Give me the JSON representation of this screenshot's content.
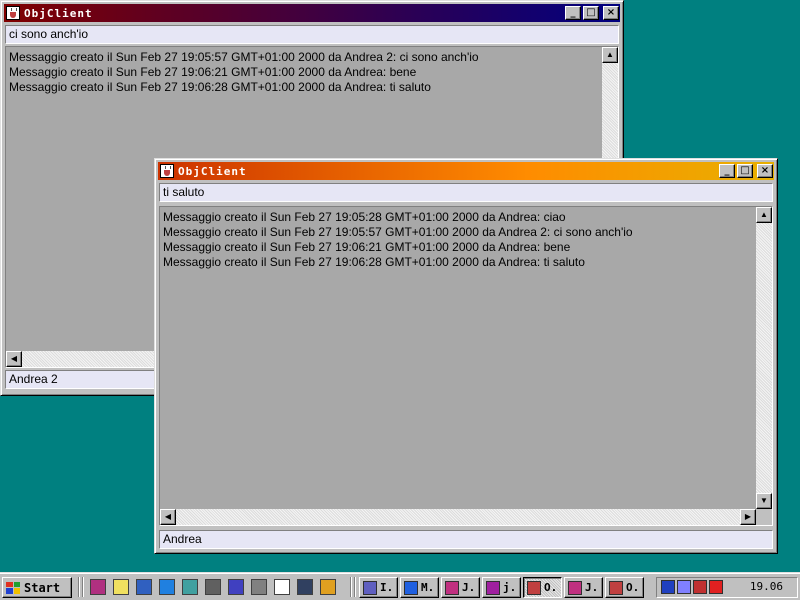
{
  "windows": {
    "back": {
      "title": "ObjClient",
      "input_value": "ci sono anch'io",
      "messages": [
        "Messaggio creato il Sun Feb 27 19:05:57 GMT+01:00 2000 da Andrea 2: ci sono anch'io",
        "Messaggio creato il Sun Feb 27 19:06:21 GMT+01:00 2000 da Andrea: bene",
        "Messaggio creato il Sun Feb 27 19:06:28 GMT+01:00 2000 da Andrea: ti saluto"
      ],
      "name_value": "Andrea 2"
    },
    "front": {
      "title": "ObjClient",
      "input_value": "ti saluto",
      "messages": [
        "Messaggio creato il Sun Feb 27 19:05:28 GMT+01:00 2000 da Andrea: ciao",
        "Messaggio creato il Sun Feb 27 19:05:57 GMT+01:00 2000 da Andrea 2: ci sono anch'io",
        "Messaggio creato il Sun Feb 27 19:06:21 GMT+01:00 2000 da Andrea: bene",
        "Messaggio creato il Sun Feb 27 19:06:28 GMT+01:00 2000 da Andrea: ti saluto"
      ],
      "name_value": "Andrea"
    }
  },
  "caption_buttons": {
    "minimize": "_",
    "maximize": "□",
    "close": "×"
  },
  "scroll_arrows": {
    "up": "▲",
    "down": "▼",
    "left": "◀",
    "right": "▶"
  },
  "taskbar": {
    "start_label": "Start",
    "quick_launch": [
      {
        "icon": "book-icon",
        "color": "#b03080"
      },
      {
        "icon": "notepad-icon",
        "color": "#f0e060"
      },
      {
        "icon": "hand-icon",
        "color": "#3060c0"
      },
      {
        "icon": "ie-icon",
        "color": "#2080e0"
      },
      {
        "icon": "network-icon",
        "color": "#40a0a0"
      },
      {
        "icon": "grid-icon",
        "color": "#606060"
      },
      {
        "icon": "arrows-icon",
        "color": "#4040c0"
      },
      {
        "icon": "pen-icon",
        "color": "#808080"
      },
      {
        "icon": "document-icon",
        "color": "#ffffff"
      },
      {
        "icon": "cards-icon",
        "color": "#304060"
      },
      {
        "icon": "paint-icon",
        "color": "#e0a020"
      }
    ],
    "tasks": [
      {
        "label": "I.",
        "icon": "app-icon",
        "color": "#6060c0",
        "active": false
      },
      {
        "label": "M.",
        "icon": "outlook-icon",
        "color": "#2060e0",
        "active": false
      },
      {
        "label": "J.",
        "icon": "jbuilder-icon",
        "color": "#c03080",
        "active": false
      },
      {
        "label": "j.",
        "icon": "jbuilder-icon",
        "color": "#a020a0",
        "active": false
      },
      {
        "label": "O.",
        "icon": "java-icon",
        "color": "#c04040",
        "active": true
      },
      {
        "label": "J.",
        "icon": "jbuilder-icon",
        "color": "#c03080",
        "active": false
      },
      {
        "label": "O.",
        "icon": "java-icon",
        "color": "#c04040",
        "active": false
      }
    ],
    "tray_icons": [
      {
        "icon": "shield-icon",
        "color": "#2040c0"
      },
      {
        "icon": "speaker-icon",
        "color": "#8080ff"
      },
      {
        "icon": "monitor-icon",
        "color": "#c03030"
      },
      {
        "icon": "printer-icon",
        "color": "#e02020"
      }
    ],
    "clock": "19.06"
  }
}
